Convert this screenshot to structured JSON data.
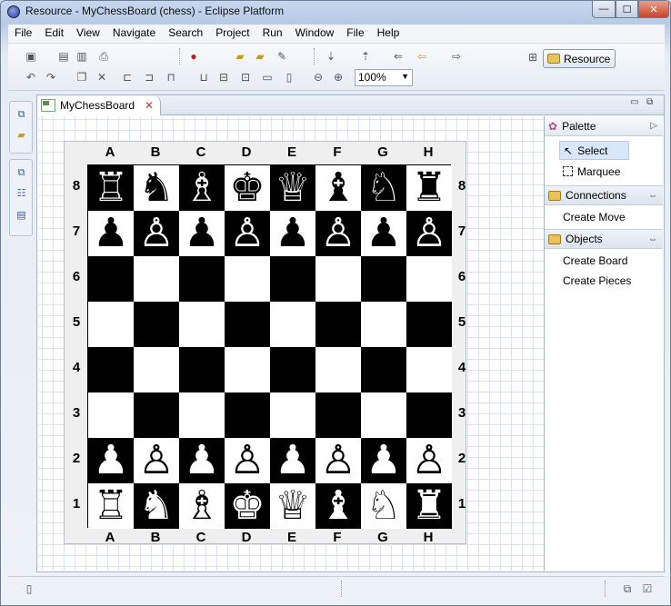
{
  "window": {
    "title": "Resource - MyChessBoard (chess) - Eclipse Platform",
    "controls": {
      "minimize": "—",
      "maximize": "☐",
      "close": "✕"
    }
  },
  "menu": [
    "File",
    "Edit",
    "View",
    "Navigate",
    "Search",
    "Project",
    "Run",
    "Window",
    "File",
    "Help"
  ],
  "toolbar": {
    "zoom_value": "100%",
    "perspective_label": "Resource"
  },
  "editor": {
    "tab_label": "MyChessBoard",
    "tab_close": "✕"
  },
  "board": {
    "files": [
      "A",
      "B",
      "C",
      "D",
      "E",
      "F",
      "G",
      "H"
    ],
    "ranks": [
      "8",
      "7",
      "6",
      "5",
      "4",
      "3",
      "2",
      "1"
    ],
    "pieces": [
      [
        "♖",
        "♞",
        "♗",
        "♚",
        "♕",
        "♝",
        "♘",
        "♜"
      ],
      [
        "♟",
        "♙",
        "♟",
        "♙",
        "♟",
        "♙",
        "♟",
        "♙"
      ],
      [
        "",
        "",
        "",
        "",
        "",
        "",
        "",
        ""
      ],
      [
        "",
        "",
        "",
        "",
        "",
        "",
        "",
        ""
      ],
      [
        "",
        "",
        "",
        "",
        "",
        "",
        "",
        ""
      ],
      [
        "",
        "",
        "",
        "",
        "",
        "",
        "",
        ""
      ],
      [
        "♟",
        "♙",
        "♟",
        "♙",
        "♟",
        "♙",
        "♟",
        "♙"
      ],
      [
        "♖",
        "♞",
        "♗",
        "♚",
        "♕",
        "♝",
        "♘",
        "♜"
      ]
    ],
    "colors": {
      "dark": "#000000",
      "light": "#ffffff"
    }
  },
  "palette": {
    "title": "Palette",
    "tools": [
      "Select",
      "Marquee"
    ],
    "connections_title": "Connections",
    "connections_items": [
      "Create Move"
    ],
    "objects_title": "Objects",
    "objects_items": [
      "Create Board",
      "Create Pieces"
    ]
  }
}
